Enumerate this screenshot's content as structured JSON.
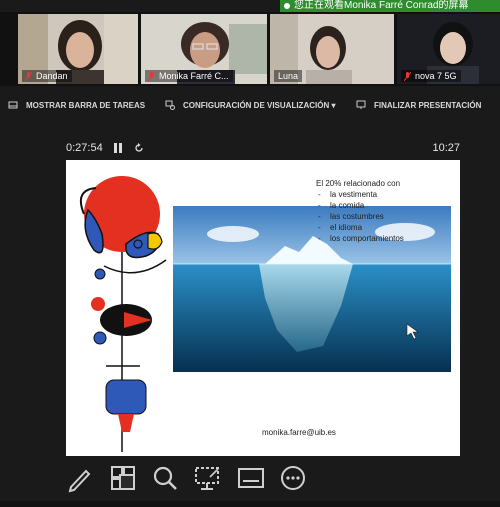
{
  "banner": {
    "text": "您正在观看Monika Farré Conrad的屏幕"
  },
  "participants": [
    {
      "name": "Dandan",
      "muted": true
    },
    {
      "name": "Monika Farré C...",
      "muted": true,
      "active": true
    },
    {
      "name": "Luna",
      "muted": false
    },
    {
      "name": "nova 7 5G",
      "muted": true
    }
  ],
  "toolbar": {
    "show_taskbar": "MOSTRAR BARRA DE TAREAS",
    "display_settings": "CONFIGURACIÓN DE VISUALIZACIÓN ▾",
    "end_presentation": "FINALIZAR PRESENTACIÓN"
  },
  "timer": {
    "elapsed": "0:27:54",
    "clock": "10:27"
  },
  "slide": {
    "heading": "El 20% relacionado con",
    "items": [
      "la vestimenta",
      "la comida",
      "las costumbres",
      "el idioma",
      "los comportamientos"
    ],
    "dash": "-",
    "email": "monika.farre@uib.es"
  },
  "tools": [
    "pen-icon",
    "grid-layout-icon",
    "magnifier-icon",
    "screen-laser-icon",
    "subtitles-icon",
    "more-icon"
  ],
  "colors": {
    "active_outline": "#8bcf45",
    "banner_green": "#2e8b2e",
    "mute_red": "#e53935"
  }
}
